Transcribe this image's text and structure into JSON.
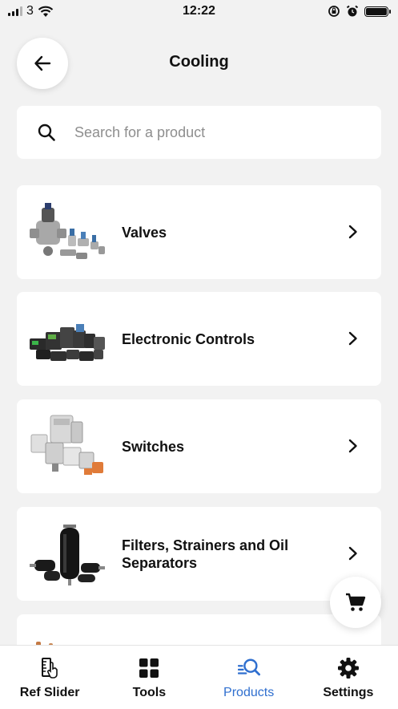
{
  "status_bar": {
    "carrier": "3",
    "time": "12:22"
  },
  "header": {
    "title": "Cooling"
  },
  "search": {
    "placeholder": "Search for a product",
    "value": ""
  },
  "categories": [
    {
      "label": "Valves",
      "image": "valves-product-image"
    },
    {
      "label": "Electronic Controls",
      "image": "electronic-controls-product-image"
    },
    {
      "label": "Switches",
      "image": "switches-product-image"
    },
    {
      "label": "Filters, Strainers and Oil Separators",
      "image": "filters-product-image"
    },
    {
      "label": "",
      "image": "copper-fittings-product-image"
    }
  ],
  "tabs": [
    {
      "label": "Ref Slider",
      "icon": "ref-slider-icon",
      "active": false
    },
    {
      "label": "Tools",
      "icon": "grid-icon",
      "active": false
    },
    {
      "label": "Products",
      "icon": "product-search-icon",
      "active": true
    },
    {
      "label": "Settings",
      "icon": "gear-icon",
      "active": false
    }
  ],
  "colors": {
    "accent": "#2f6fcf",
    "background": "#f2f2f2",
    "card": "#ffffff"
  }
}
